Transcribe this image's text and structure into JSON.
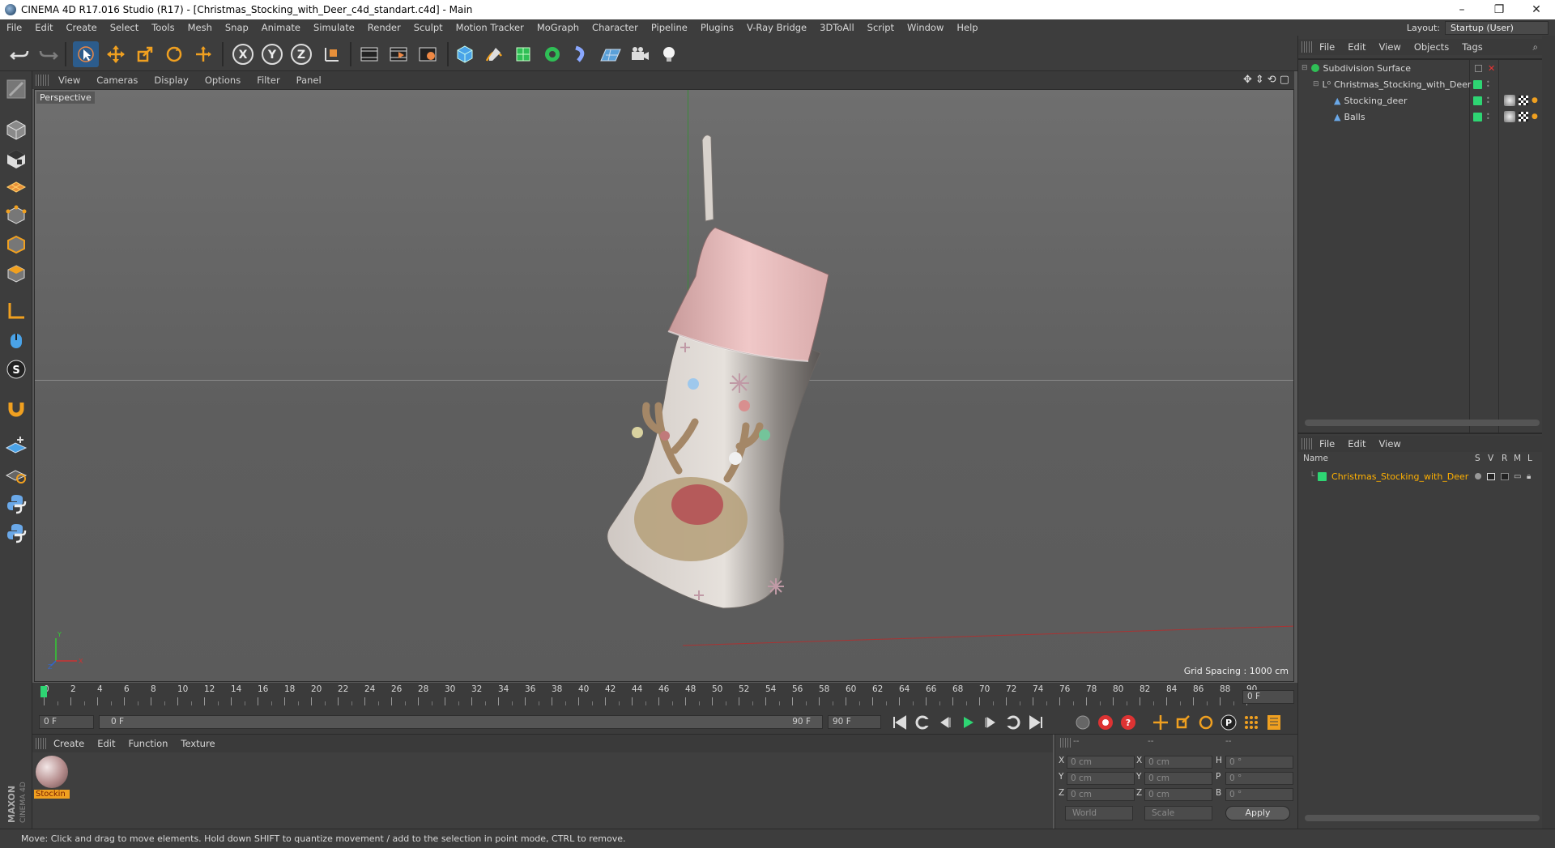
{
  "window": {
    "title": "CINEMA 4D R17.016 Studio (R17) - [Christmas_Stocking_with_Deer_c4d_standart.c4d] - Main",
    "buttons": [
      "–",
      "❐",
      "✕"
    ]
  },
  "menubar": {
    "items": [
      "File",
      "Edit",
      "Create",
      "Select",
      "Tools",
      "Mesh",
      "Snap",
      "Animate",
      "Simulate",
      "Render",
      "Sculpt",
      "Motion Tracker",
      "MoGraph",
      "Character",
      "Pipeline",
      "Plugins",
      "V-Ray Bridge",
      "3DToAll",
      "Script",
      "Window",
      "Help"
    ],
    "layout_label": "Layout:",
    "layout_value": "Startup (User)"
  },
  "toolbar": {
    "axis_x": "X",
    "axis_y": "Y",
    "axis_z": "Z"
  },
  "viewport": {
    "menu": [
      "View",
      "Cameras",
      "Display",
      "Options",
      "Filter",
      "Panel"
    ],
    "label": "Perspective",
    "grid_spacing": "Grid Spacing : 1000 cm",
    "axis_x": "X",
    "axis_y": "Y",
    "axis_z": "Z"
  },
  "timeline": {
    "ticks": [
      "0",
      "2",
      "4",
      "6",
      "8",
      "10",
      "12",
      "14",
      "16",
      "18",
      "20",
      "22",
      "24",
      "26",
      "28",
      "30",
      "32",
      "34",
      "36",
      "38",
      "40",
      "42",
      "44",
      "46",
      "48",
      "50",
      "52",
      "54",
      "56",
      "58",
      "60",
      "62",
      "64",
      "66",
      "68",
      "70",
      "72",
      "74",
      "76",
      "78",
      "80",
      "82",
      "84",
      "86",
      "88",
      "90"
    ],
    "current_frame": "0 F",
    "start_field": "0 F",
    "range_start": "0 F",
    "range_end": "90 F",
    "end_field": "90 F"
  },
  "material_manager": {
    "menu": [
      "Create",
      "Edit",
      "Function",
      "Texture"
    ],
    "material_label": "Stockin"
  },
  "coordinates": {
    "headers": [
      "--",
      "--",
      "--"
    ],
    "rows": [
      {
        "l1": "X",
        "v1": "0 cm",
        "l2": "X",
        "v2": "0 cm",
        "l3": "H",
        "v3": "0 °"
      },
      {
        "l1": "Y",
        "v1": "0 cm",
        "l2": "Y",
        "v2": "0 cm",
        "l3": "P",
        "v3": "0 °"
      },
      {
        "l1": "Z",
        "v1": "0 cm",
        "l2": "Z",
        "v2": "0 cm",
        "l3": "B",
        "v3": "0 °"
      }
    ],
    "mode": "World",
    "size": "Scale",
    "apply": "Apply"
  },
  "object_manager": {
    "menu": [
      "File",
      "Edit",
      "View",
      "Objects",
      "Tags"
    ],
    "objects": [
      {
        "name": "Subdivision Surface",
        "indent": 0
      },
      {
        "name": "Christmas_Stocking_with_Deer",
        "indent": 1
      },
      {
        "name": "Stocking_deer",
        "indent": 2
      },
      {
        "name": "Balls",
        "indent": 2
      }
    ]
  },
  "layers_manager": {
    "menu": [
      "File",
      "Edit",
      "View"
    ],
    "columns": [
      "Name",
      "S",
      "V",
      "R",
      "M",
      "L"
    ],
    "layer_name": "Christmas_Stocking_with_Deer"
  },
  "status": {
    "text": "Move: Click and drag to move elements. Hold down SHIFT to quantize movement / add to the selection in point mode, CTRL to remove."
  },
  "branding": "MAXON CINEMA 4D",
  "colors": {
    "accent": "#2c5c8c",
    "layer_green": "#2ed573",
    "layer_text": "#ffb000"
  }
}
